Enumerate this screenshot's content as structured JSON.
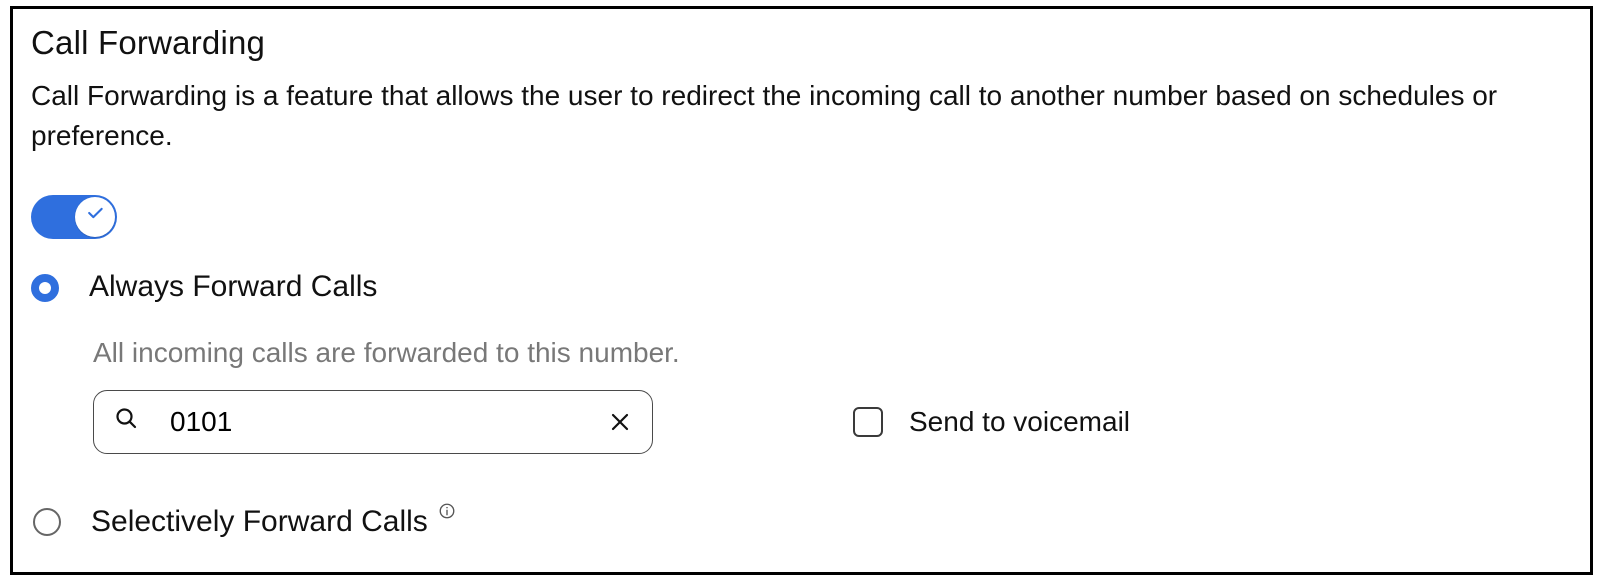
{
  "title": "Call Forwarding",
  "description": "Call Forwarding is a feature that allows the user to redirect the incoming call to another number based on schedules or preference.",
  "toggle": {
    "enabled": true
  },
  "options": {
    "always": {
      "label": "Always Forward Calls",
      "selected": true,
      "subtext": "All incoming calls are forwarded to this number.",
      "number_value": "0101"
    },
    "selectively": {
      "label": "Selectively Forward Calls",
      "selected": false
    }
  },
  "voicemail": {
    "label": "Send to voicemail",
    "checked": false
  }
}
